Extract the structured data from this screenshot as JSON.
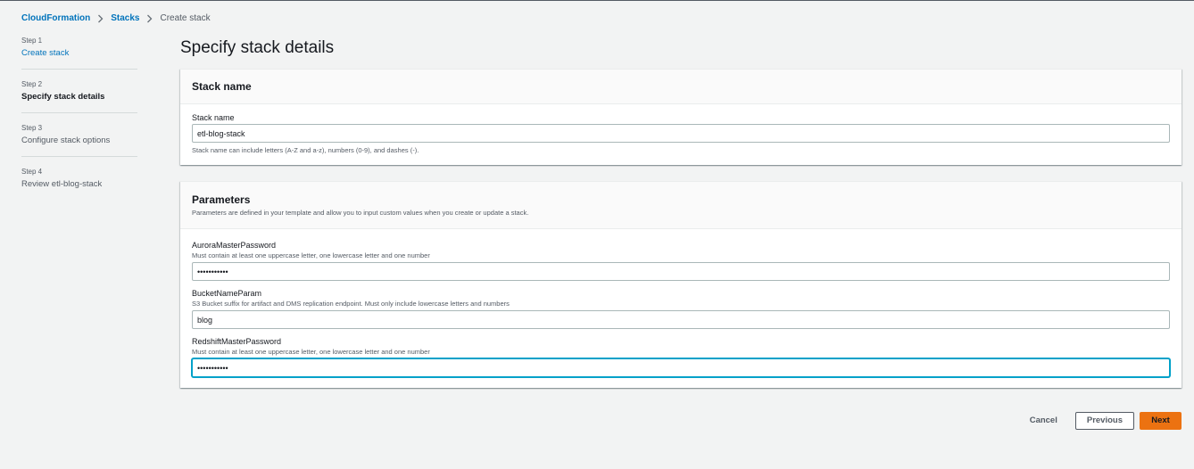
{
  "breadcrumb": {
    "items": [
      "CloudFormation",
      "Stacks"
    ],
    "current": "Create stack"
  },
  "steps": [
    {
      "num": "Step 1",
      "label": "Create stack"
    },
    {
      "num": "Step 2",
      "label": "Specify stack details"
    },
    {
      "num": "Step 3",
      "label": "Configure stack options"
    },
    {
      "num": "Step 4",
      "label": "Review etl-blog-stack"
    }
  ],
  "page_title": "Specify stack details",
  "stack_name_panel": {
    "title": "Stack name",
    "field_label": "Stack name",
    "value": "etl-blog-stack",
    "hint": "Stack name can include letters (A-Z and a-z), numbers (0-9), and dashes (-)."
  },
  "parameters_panel": {
    "title": "Parameters",
    "description": "Parameters are defined in your template and allow you to input custom values when you create or update a stack.",
    "fields": [
      {
        "label": "AuroraMasterPassword",
        "desc": "Must contain at least one uppercase letter, one lowercase letter and one number",
        "value": "•••••••••••"
      },
      {
        "label": "BucketNameParam",
        "desc": "S3 Bucket suffix for artifact and DMS replication endpoint. Must only include lowercase letters and numbers",
        "value": "blog"
      },
      {
        "label": "RedshiftMasterPassword",
        "desc": "Must contain at least one uppercase letter, one lowercase letter and one number",
        "value": "•••••••••••"
      }
    ]
  },
  "actions": {
    "cancel": "Cancel",
    "previous": "Previous",
    "next": "Next"
  },
  "colors": {
    "link": "#0073bb",
    "primary": "#ec7211",
    "focus": "#00a1c9",
    "background": "#f2f3f3"
  },
  "icons": {
    "breadcrumb_separator": "chevron-right-icon"
  }
}
